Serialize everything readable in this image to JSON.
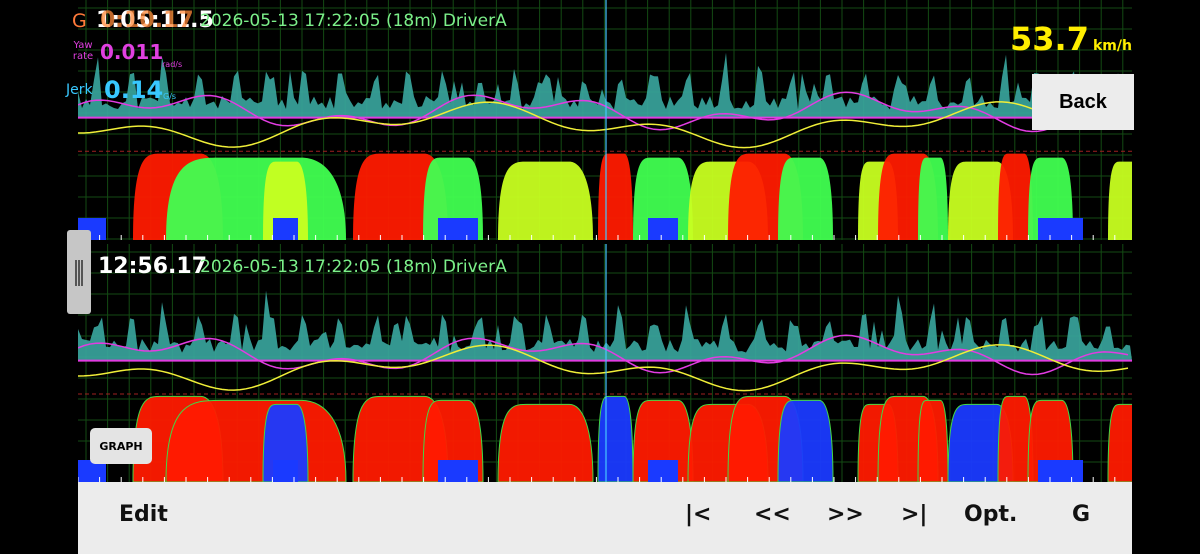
{
  "top_panel": {
    "g_label": "G",
    "time": "1:05:11.5",
    "time_overlay": "0:10.17",
    "meta": "2026-05-13 17:22:05 (18m) DriverA",
    "yaw": {
      "label": "Yaw rate",
      "value": "0.011",
      "unit": "rad/s"
    },
    "jerk": {
      "label": "Jerk",
      "value": "0.14",
      "unit": "G/s"
    }
  },
  "speed": {
    "value": "53.7",
    "unit": "km/h"
  },
  "back_button": "Back",
  "bottom_panel": {
    "time": "12:56.17",
    "meta": "2026-05-13 17:22:05 (18m) DriverA",
    "graph_badge": "GRAPH"
  },
  "toolbar": {
    "edit": "Edit",
    "first": "|<",
    "prev": "<<",
    "next": ">>",
    "last": ">|",
    "options": "Opt.",
    "g": "G"
  },
  "colors": {
    "grid": "#134a13",
    "teal_area": "#3aa7a0",
    "magenta_line": "#e23ce2",
    "yellow_line": "#f0ee38",
    "accel_red": "#ff1a00",
    "brake_blue": "#1a3aff",
    "cursor": "#46c8ff",
    "speed_text": "#ffee00"
  }
}
